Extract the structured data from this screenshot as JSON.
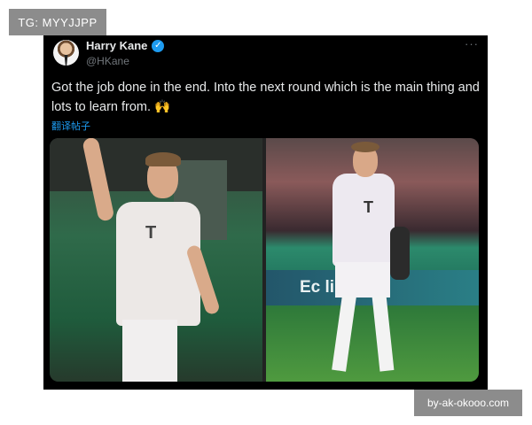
{
  "watermarks": {
    "top_left": "TG: MYYJJPP",
    "bottom_right": "by-ak-okooo.com"
  },
  "tweet": {
    "display_name": "Harry Kane",
    "handle": "@HKane",
    "verified_icon": "verified-badge-icon",
    "more_icon": "more-options-icon",
    "text": "Got the job done in the end. Into the next round which is the main thing and lots to learn from. 🙌",
    "translate_label": "翻译帖子"
  },
  "media": {
    "photos": [
      "left-photo",
      "right-photo"
    ],
    "ad_board_text": "Ec   limit"
  },
  "colors": {
    "card_background": "#000000",
    "text": "#e7e9ea",
    "secondary": "#71767b",
    "link_blue": "#1d9bf0",
    "watermark_bg": "#8c8c8c"
  }
}
